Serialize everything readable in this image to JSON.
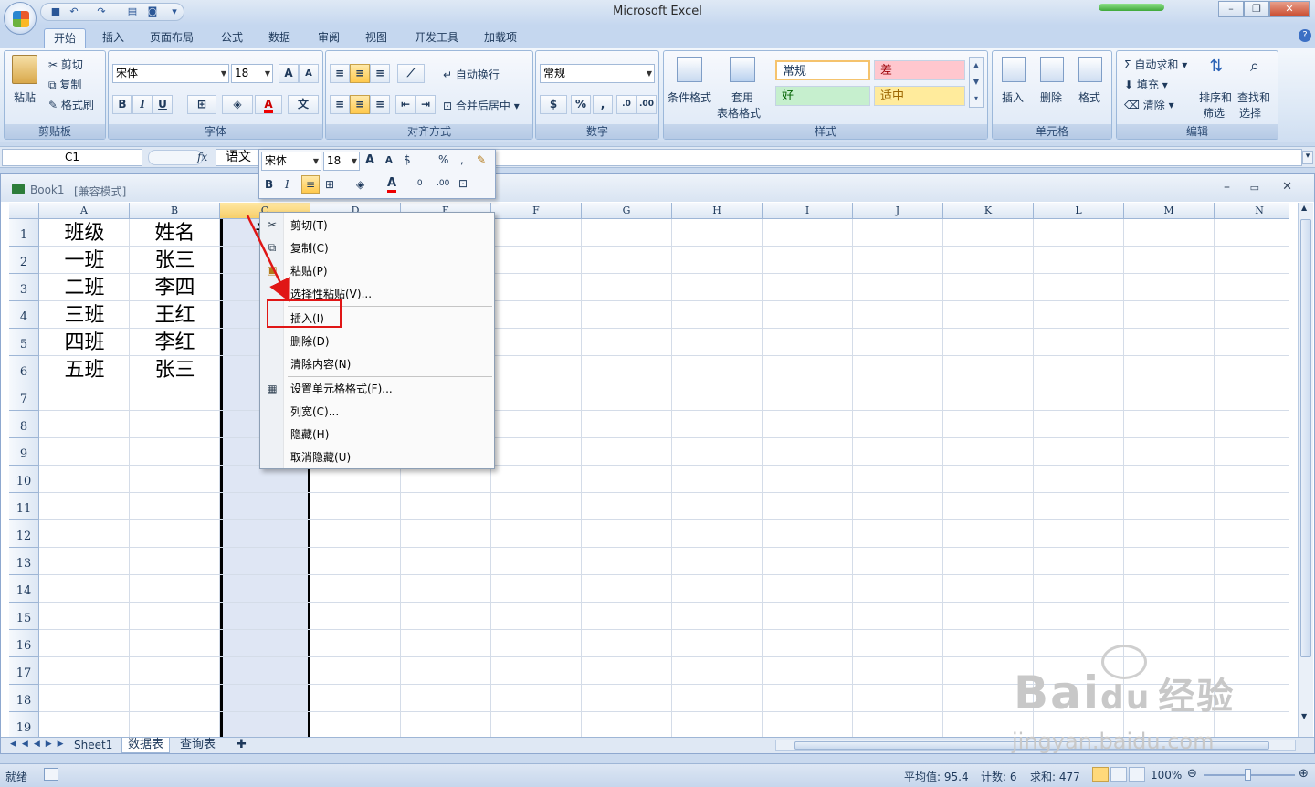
{
  "app": {
    "title": "Microsoft Excel"
  },
  "ribbon_tabs": [
    "开始",
    "插入",
    "页面布局",
    "公式",
    "数据",
    "审阅",
    "视图",
    "开发工具",
    "加载项"
  ],
  "clipboard": {
    "paste": "粘贴",
    "cut": "剪切",
    "copy": "复制",
    "format_painter": "格式刷",
    "label": "剪贴板"
  },
  "font": {
    "name": "宋体",
    "size": "18",
    "label": "字体",
    "bold": "B",
    "italic": "I",
    "underline": "U"
  },
  "alignment": {
    "wrap": "自动换行",
    "merge": "合并后居中",
    "label": "对齐方式"
  },
  "number": {
    "format": "常规",
    "label": "数字"
  },
  "styles": {
    "conditional": "条件格式",
    "table_style_1": "套用",
    "table_style_2": "表格格式",
    "normal": "常规",
    "bad": "差",
    "good": "好",
    "neutral": "适中",
    "label": "样式",
    "colors": {
      "bad_bg": "#ffc7ce",
      "bad_fg": "#9c0006",
      "good_bg": "#c6efce",
      "good_fg": "#006100",
      "neutral_bg": "#ffeb9c",
      "neutral_fg": "#9c6500"
    }
  },
  "cells_group": {
    "insert": "插入",
    "delete": "删除",
    "format": "格式",
    "label": "单元格"
  },
  "editing": {
    "autosum": "自动求和",
    "fill": "填充",
    "clear": "清除",
    "sort_1": "排序和",
    "sort_2": "筛选",
    "find_1": "查找和",
    "find_2": "选择",
    "label": "编辑"
  },
  "formula_bar": {
    "name_box": "C1",
    "fx": "fx",
    "content": "语文"
  },
  "workbook": {
    "title": "Book1",
    "mode": "[兼容模式]"
  },
  "columns": [
    "A",
    "B",
    "C",
    "D",
    "E",
    "F",
    "G",
    "H",
    "I",
    "J",
    "K",
    "L",
    "M",
    "N"
  ],
  "rows": [
    "1",
    "2",
    "3",
    "4",
    "5",
    "6",
    "7",
    "8",
    "9",
    "10",
    "11",
    "12",
    "13",
    "14",
    "15",
    "16",
    "17",
    "18",
    "19"
  ],
  "table": [
    [
      "班级",
      "姓名",
      "语"
    ],
    [
      "一班",
      "张三",
      "9"
    ],
    [
      "二班",
      "李四",
      "9"
    ],
    [
      "三班",
      "王红",
      "9"
    ],
    [
      "四班",
      "李红",
      "9"
    ],
    [
      "五班",
      "张三",
      "9"
    ]
  ],
  "mini_toolbar": {
    "font": "宋体",
    "size": "18"
  },
  "context_menu": {
    "items": [
      "剪切(T)",
      "复制(C)",
      "粘贴(P)",
      "选择性粘贴(V)...",
      "插入(I)",
      "删除(D)",
      "清除内容(N)",
      "设置单元格格式(F)...",
      "列宽(C)...",
      "隐藏(H)",
      "取消隐藏(U)"
    ]
  },
  "sheet_tabs": [
    "Sheet1",
    "数据表",
    "查询表"
  ],
  "status": {
    "ready": "就绪",
    "average": "平均值: 95.4",
    "count": "计数: 6",
    "sum": "求和: 477",
    "zoom": "100%"
  },
  "watermark": {
    "brand": "Bai",
    "brand2": "du",
    "site": "经验",
    "url": "jingyan.baidu.com"
  }
}
